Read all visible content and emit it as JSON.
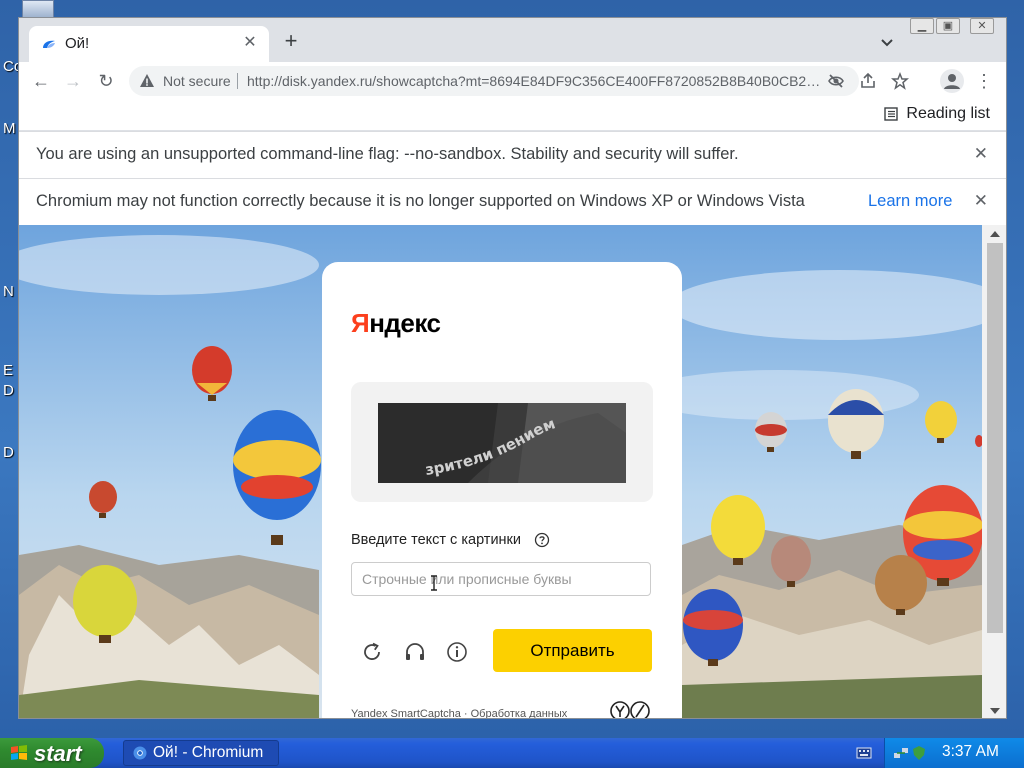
{
  "desktop": {
    "fragments": [
      "Co",
      "M",
      "N",
      "E",
      "D",
      "D"
    ]
  },
  "browser": {
    "tab": {
      "title": "Ой!"
    },
    "toolbar": {
      "security_label": "Not secure",
      "url": "http://disk.yandex.ru/showcaptcha?mt=8694E84DF9C356CE400FF8720852B8B40B0CB2A..."
    },
    "bookmarks": {
      "reading_list": "Reading list"
    },
    "infobars": [
      {
        "text": "You are using an unsupported command-line flag: --no-sandbox. Stability and security will suffer."
      },
      {
        "text": "Chromium may not function correctly because it is no longer supported on Windows XP or Windows Vista",
        "link": "Learn more"
      }
    ]
  },
  "captcha": {
    "logo": {
      "first": "Я",
      "rest": "ндекс"
    },
    "image_text": "зрители пением",
    "prompt": "Введите текст с картинки",
    "input_placeholder": "Строчные или прописные буквы",
    "submit_label": "Отправить",
    "footer": "Yandex SmartCaptcha · Обработка данных"
  },
  "taskbar": {
    "start_label": "start",
    "task_label": "Ой! - Chromium",
    "clock": "3:37 AM"
  },
  "colors": {
    "yandex_red": "#fc3f1d",
    "submit_yellow": "#fcd000",
    "link_blue": "#1a73e8"
  },
  "icons": [
    "warning-icon",
    "eye-off-icon",
    "share-icon",
    "star-icon",
    "profile-icon",
    "menu-icon",
    "reading-list-icon",
    "refresh-icon",
    "headphones-icon",
    "info-icon",
    "help-icon"
  ]
}
